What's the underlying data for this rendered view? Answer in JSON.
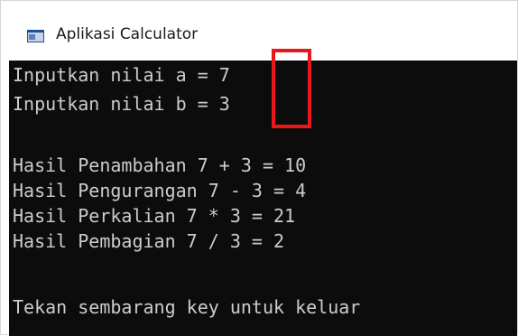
{
  "window": {
    "title": "Aplikasi Calculator",
    "icon": "console-app-icon"
  },
  "console": {
    "lines": [
      "Inputkan nilai a = 7",
      "Inputkan nilai b = 3",
      "",
      "Hasil Penambahan 7 + 3 = 10",
      "Hasil Pengurangan 7 - 3 = 4",
      "Hasil Perkalian 7 * 3 = 21",
      "Hasil Pembagian 7 / 3 = 2",
      "",
      "Tekan sembarang key untuk keluar"
    ],
    "background": "#0c0c0c",
    "text_color": "#cccccc"
  },
  "annotation": {
    "color": "#e8171c"
  }
}
